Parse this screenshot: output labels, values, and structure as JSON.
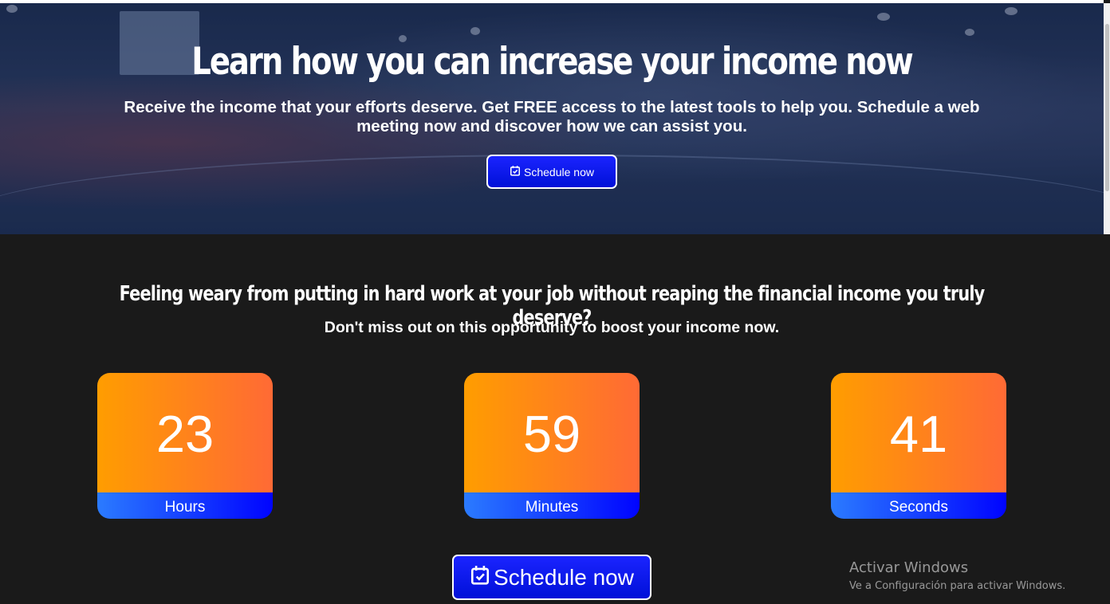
{
  "hero": {
    "title": "Learn how you can increase your income now",
    "subtitle": "Receive the income that your efforts deserve. Get FREE access to the latest tools to help you. Schedule a web meeting now and discover how we can assist you.",
    "button_label": "Schedule now",
    "button_icon": "calendar-check-icon"
  },
  "main": {
    "title": "Feeling weary from putting in hard work at your job without reaping the financial income you truly deserve?",
    "subtitle": "Don't miss out on this opportunity to boost your income now.",
    "counters": [
      {
        "value": "23",
        "label": "Hours"
      },
      {
        "value": "59",
        "label": "Minutes"
      },
      {
        "value": "41",
        "label": "Seconds"
      }
    ],
    "button_label": "Schedule now",
    "button_icon": "calendar-check-icon"
  },
  "watermark": {
    "title": "Activar Windows",
    "subtitle": "Ve a Configuración para activar Windows."
  },
  "colors": {
    "button_blue": "#0010d8",
    "counter_orange_start": "#ff9d00",
    "counter_orange_end": "#ff6a35",
    "counter_blue_start": "#2b7bff",
    "counter_blue_end": "#0004ff",
    "page_background": "#1a1a1a"
  }
}
